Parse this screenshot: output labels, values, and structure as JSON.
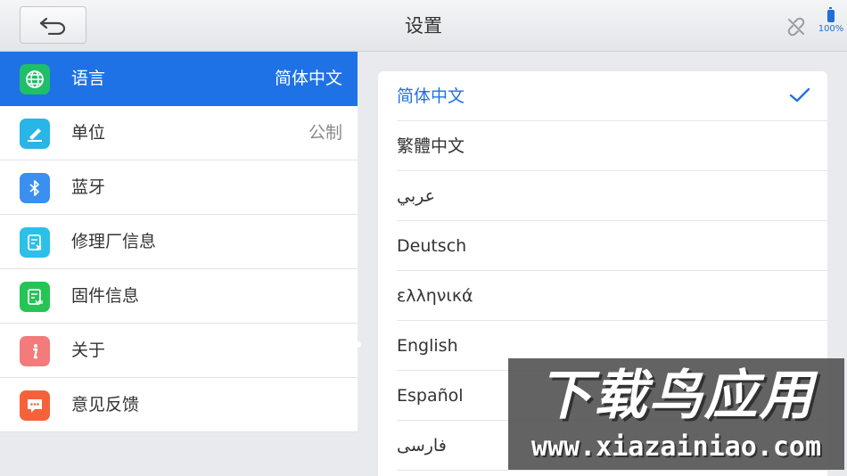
{
  "header": {
    "title": "设置",
    "back_icon": "back-arrow-icon",
    "link_icon": "unlinked-icon",
    "battery_level": "100%",
    "accent_color": "#1f6fd6"
  },
  "sidebar": {
    "items": [
      {
        "label": "语言",
        "value": "简体中文",
        "icon": "globe-icon",
        "icon_color": "#1fbf68",
        "active": true
      },
      {
        "label": "单位",
        "value": "公制",
        "icon": "ruler-icon",
        "icon_color": "#27b6e6",
        "active": false
      },
      {
        "label": "蓝牙",
        "value": "",
        "icon": "bluetooth-icon",
        "icon_color": "#3a8ff0",
        "active": false
      },
      {
        "label": "修理厂信息",
        "value": "",
        "icon": "shop-info-icon",
        "icon_color": "#2cc0e8",
        "active": false
      },
      {
        "label": "固件信息",
        "value": "",
        "icon": "firmware-icon",
        "icon_color": "#25c455",
        "active": false
      },
      {
        "label": "关于",
        "value": "",
        "icon": "info-icon",
        "icon_color": "#f47b7b",
        "active": false
      },
      {
        "label": "意见反馈",
        "value": "",
        "icon": "feedback-icon",
        "icon_color": "#f5623a",
        "active": false
      }
    ]
  },
  "languages": {
    "selected": "简体中文",
    "items": [
      "简体中文",
      "繁體中文",
      "عربي",
      "Deutsch",
      "ελληνικά",
      "English",
      "Español",
      "فارسی"
    ]
  },
  "watermark": {
    "main": "下载鸟应用",
    "url": "www.xiazainiao.com"
  }
}
